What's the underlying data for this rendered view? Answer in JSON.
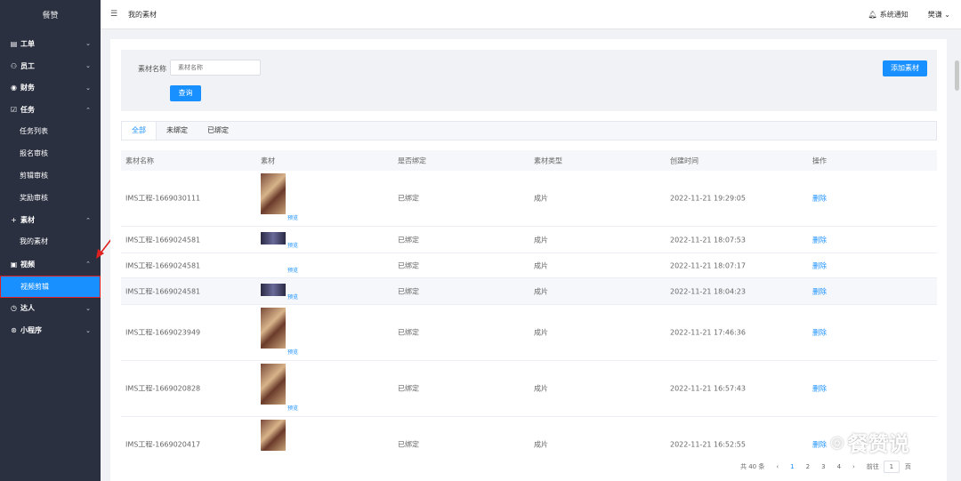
{
  "sidebar": {
    "logo": "餐赞",
    "items": [
      {
        "label": "工单",
        "icon": "document-icon",
        "chevron": "down"
      },
      {
        "label": "员工",
        "icon": "user-icon",
        "chevron": "down"
      },
      {
        "label": "财务",
        "icon": "finance-icon",
        "chevron": "down"
      },
      {
        "label": "任务",
        "icon": "checkbox-icon",
        "chevron": "up",
        "children": [
          "任务列表",
          "报名审核",
          "剪辑审核",
          "奖励审核"
        ]
      },
      {
        "label": "素材",
        "icon": "plus-icon",
        "chevron": "up",
        "children": [
          "我的素材"
        ]
      },
      {
        "label": "视频",
        "icon": "video-icon",
        "chevron": "up",
        "children": [
          "视频剪辑"
        ]
      },
      {
        "label": "达人",
        "icon": "clock-icon",
        "chevron": "down"
      },
      {
        "label": "小程序",
        "icon": "miniapp-icon",
        "chevron": "down"
      }
    ],
    "active_sub": "视频剪辑"
  },
  "topbar": {
    "breadcrumb": "我的素材",
    "notify": "系统通知",
    "user": "樊谦"
  },
  "filter": {
    "label": "素材名称",
    "placeholder": "素材名称",
    "query_button": "查询",
    "add_button": "添加素材"
  },
  "tabs": [
    "全部",
    "未绑定",
    "已绑定"
  ],
  "table": {
    "headers": [
      "素材名称",
      "素材",
      "是否绑定",
      "素材类型",
      "创建时间",
      "操作"
    ],
    "preview_label": "预览",
    "rows": [
      {
        "name": "IMS工程-1669030111",
        "bound": "已绑定",
        "type": "成片",
        "time": "2022-11-21 19:29:05",
        "action": "删除"
      },
      {
        "name": "IMS工程-1669024581",
        "bound": "已绑定",
        "type": "成片",
        "time": "2022-11-21 18:07:53",
        "action": "删除"
      },
      {
        "name": "IMS工程-1669024581",
        "bound": "已绑定",
        "type": "成片",
        "time": "2022-11-21 18:07:17",
        "action": "删除"
      },
      {
        "name": "IMS工程-1669024581",
        "bound": "已绑定",
        "type": "成片",
        "time": "2022-11-21 18:04:23",
        "action": "删除"
      },
      {
        "name": "IMS工程-1669023949",
        "bound": "已绑定",
        "type": "成片",
        "time": "2022-11-21 17:46:36",
        "action": "删除"
      },
      {
        "name": "IMS工程-1669020828",
        "bound": "已绑定",
        "type": "成片",
        "time": "2022-11-21 16:57:43",
        "action": "删除"
      },
      {
        "name": "IMS工程-1669020417",
        "bound": "已绑定",
        "type": "成片",
        "time": "2022-11-21 16:52:55",
        "action": "删除"
      }
    ]
  },
  "pagination": {
    "total": "共 40 条",
    "pages": [
      "1",
      "2",
      "3",
      "4"
    ],
    "current": "1",
    "goto_label": "前往",
    "goto_value": "1",
    "page_suffix": "页"
  },
  "watermark": "餐赞说",
  "colors": {
    "primary": "#1890ff",
    "sidebar": "#2b3040",
    "highlight": "#e02020"
  }
}
